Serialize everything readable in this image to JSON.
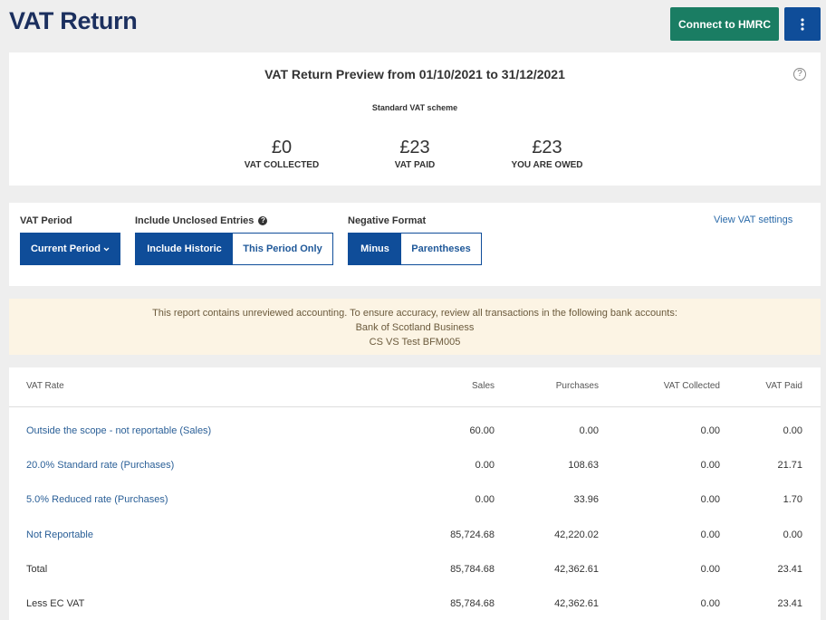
{
  "header": {
    "title": "VAT Return",
    "connect_label": "Connect to HMRC"
  },
  "summary": {
    "title": "VAT Return Preview from 01/10/2021 to 31/12/2021",
    "scheme": "Standard VAT scheme",
    "help_glyph": "?",
    "stats": [
      {
        "amount": "£0",
        "label": "VAT COLLECTED"
      },
      {
        "amount": "£23",
        "label": "VAT PAID"
      },
      {
        "amount": "£23",
        "label": "YOU ARE OWED"
      }
    ]
  },
  "controls": {
    "vat_period_label": "VAT Period",
    "vat_period_value": "Current Period",
    "unclosed_label": "Include Unclosed Entries",
    "unclosed_options": [
      "Include Historic",
      "This Period Only"
    ],
    "negative_label": "Negative Format",
    "negative_options": [
      "Minus",
      "Parentheses"
    ],
    "settings_link": "View VAT settings"
  },
  "warning": {
    "message": "This report contains unreviewed accounting. To ensure accuracy, review all transactions in the following bank accounts:",
    "accounts": [
      "Bank of Scotland Business",
      "CS VS Test BFM005"
    ]
  },
  "table": {
    "headers": [
      "VAT Rate",
      "Sales",
      "Purchases",
      "VAT Collected",
      "VAT Paid"
    ],
    "rows": [
      {
        "rate": "Outside the scope - not reportable (Sales)",
        "sales": "60.00",
        "purchases": "0.00",
        "collected": "0.00",
        "paid": "0.00",
        "link": true
      },
      {
        "rate": "20.0% Standard rate (Purchases)",
        "sales": "0.00",
        "purchases": "108.63",
        "collected": "0.00",
        "paid": "21.71",
        "link": true
      },
      {
        "rate": "5.0% Reduced rate (Purchases)",
        "sales": "0.00",
        "purchases": "33.96",
        "collected": "0.00",
        "paid": "1.70",
        "link": true
      },
      {
        "rate": "Not Reportable",
        "sales": "85,724.68",
        "purchases": "42,220.02",
        "collected": "0.00",
        "paid": "0.00",
        "link": true
      },
      {
        "rate": "Total",
        "sales": "85,784.68",
        "purchases": "42,362.61",
        "collected": "0.00",
        "paid": "23.41",
        "link": false
      },
      {
        "rate": "Less EC VAT",
        "sales": "85,784.68",
        "purchases": "42,362.61",
        "collected": "0.00",
        "paid": "23.41",
        "link": false
      }
    ]
  },
  "colors": {
    "title_navy": "#1b2f5e",
    "primary_blue": "#0f4d99",
    "hmrc_green": "#1a7d63",
    "link_blue": "#2a5f97",
    "warning_bg": "#fcf4e4"
  }
}
